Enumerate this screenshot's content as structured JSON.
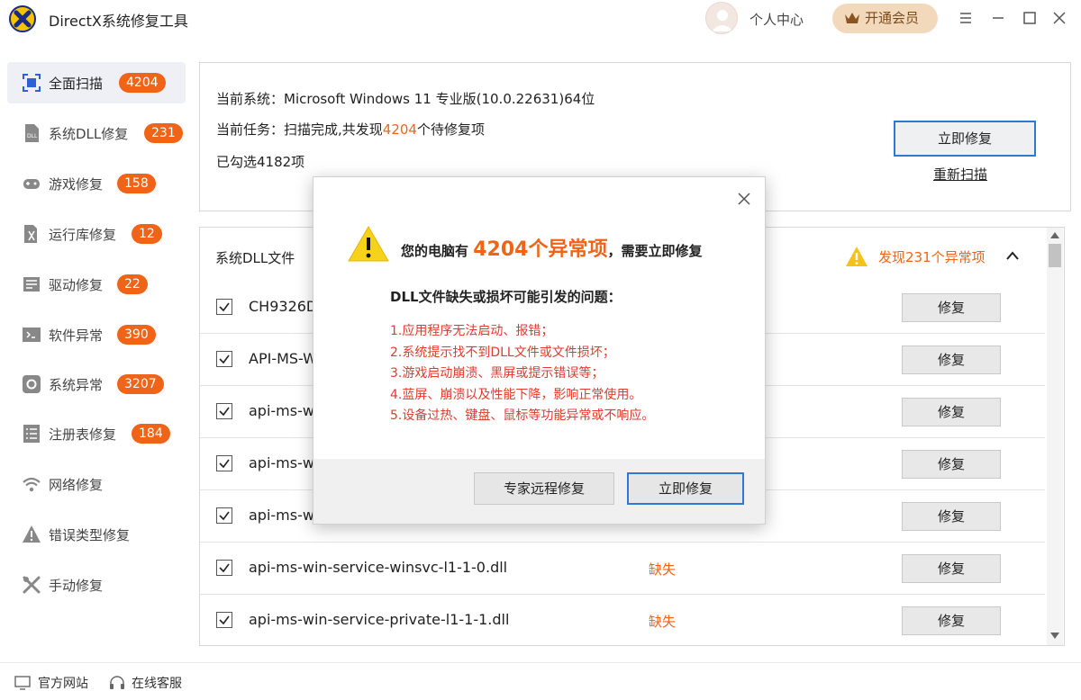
{
  "app": {
    "title": "DirectX系统修复工具",
    "user_center": "个人中心",
    "vip_label": "开通会员"
  },
  "sidebar": {
    "items": [
      {
        "label": "全面扫描",
        "badge": "4204",
        "icon": "scan-icon"
      },
      {
        "label": "系统DLL修复",
        "badge": "231",
        "icon": "dll-icon"
      },
      {
        "label": "游戏修复",
        "badge": "158",
        "icon": "gamepad-icon"
      },
      {
        "label": "运行库修复",
        "badge": "12",
        "icon": "runtime-icon"
      },
      {
        "label": "驱动修复",
        "badge": "22",
        "icon": "driver-icon"
      },
      {
        "label": "软件异常",
        "badge": "390",
        "icon": "software-icon"
      },
      {
        "label": "系统异常",
        "badge": "3207",
        "icon": "gear-icon"
      },
      {
        "label": "注册表修复",
        "badge": "184",
        "icon": "registry-icon"
      },
      {
        "label": "网络修复",
        "badge": "",
        "icon": "wifi-icon"
      },
      {
        "label": "错误类型修复",
        "badge": "",
        "icon": "warning-icon"
      },
      {
        "label": "手动修复",
        "badge": "",
        "icon": "tools-icon"
      }
    ]
  },
  "info": {
    "system_line": "当前系统：Microsoft Windows 11 专业版(10.0.22631)64位",
    "task_prefix": "当前任务：扫描完成,共发现",
    "task_count": "4204",
    "task_suffix": "个待修复项",
    "selected": "已勾选4182项",
    "fix_now": "立即修复",
    "rescan": "重新扫描"
  },
  "list": {
    "header": "系统DLL文件",
    "warn": "发现231个异常项",
    "fix_label": "修复",
    "rows": [
      {
        "name": "CH9326D",
        "status": ""
      },
      {
        "name": "API-MS-W",
        "status": ""
      },
      {
        "name": "api-ms-w",
        "status": ""
      },
      {
        "name": "api-ms-w",
        "status": ""
      },
      {
        "name": "api-ms-w",
        "status": ""
      },
      {
        "name": "api-ms-win-service-winsvc-l1-1-0.dll",
        "status": "缺失"
      },
      {
        "name": "api-ms-win-service-private-l1-1-1.dll",
        "status": "缺失"
      }
    ]
  },
  "footer": {
    "website": "官方网站",
    "support": "在线客服"
  },
  "modal": {
    "head_prefix": "您的电脑有",
    "head_count": "4204个异常项",
    "head_suffix": "，需要立即修复",
    "subtitle": "DLL文件缺失或损坏可能引发的问题：",
    "issues": [
      "1.应用程序无法启动、报错；",
      "2.系统提示找不到DLL文件或文件损坏；",
      "3.游戏启动崩溃、黑屏或提示错误等；",
      "4.蓝屏、崩溃以及性能下降，影响正常使用。",
      "5.设备过热、键盘、鼠标等功能异常或不响应。"
    ],
    "remote_button": "专家远程修复",
    "fix_button": "立即修复"
  },
  "colors": {
    "accent": "#f06418",
    "primary_border": "#2e78d6",
    "warning_red": "#e23a2e"
  }
}
